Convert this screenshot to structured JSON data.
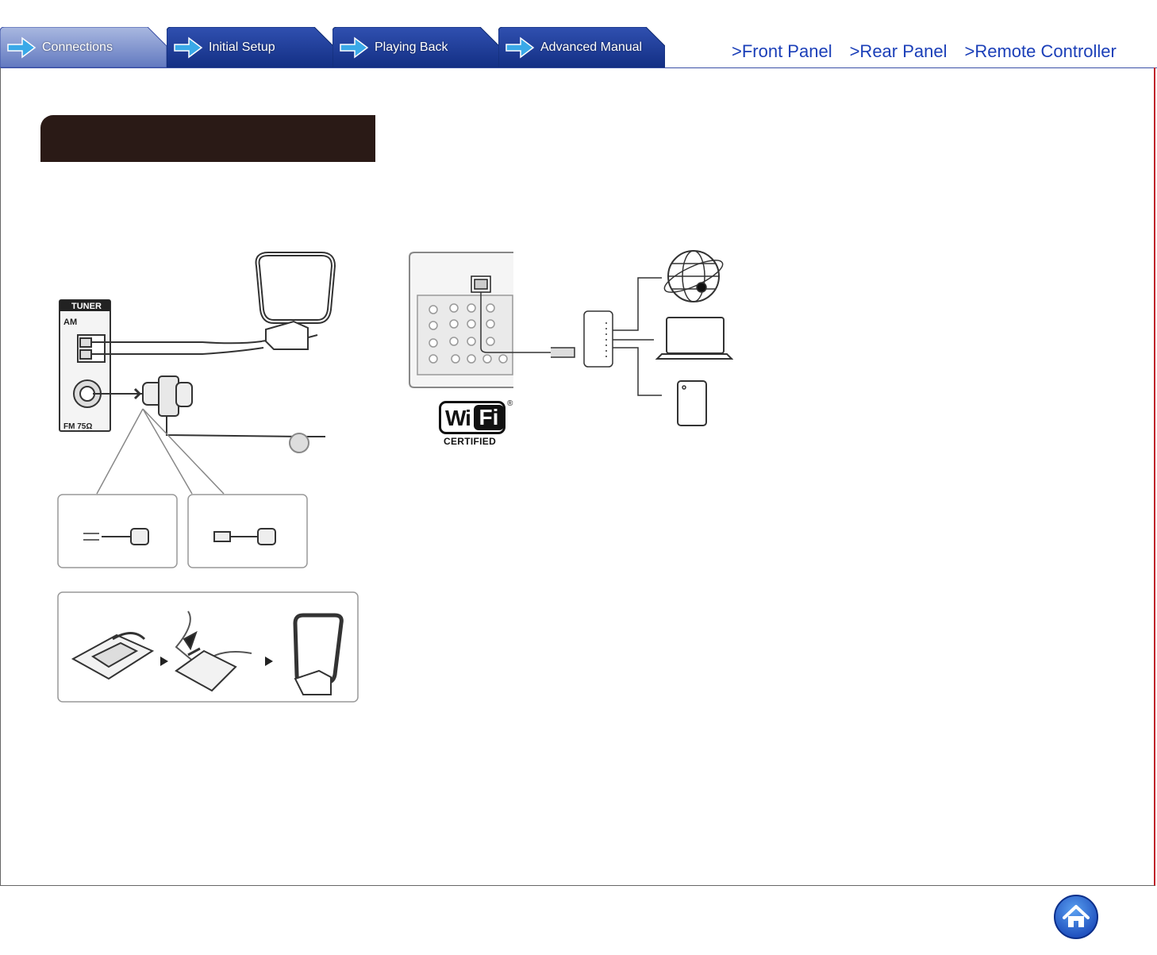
{
  "tabs": [
    {
      "label": "Connections",
      "active": true
    },
    {
      "label": "Initial Setup",
      "active": false
    },
    {
      "label": "Playing Back",
      "active": false
    },
    {
      "label": "Advanced Manual",
      "active": false
    }
  ],
  "links": {
    "front_panel": ">Front Panel",
    "rear_panel": ">Rear Panel",
    "remote_controller": ">Remote Controller"
  },
  "section": {
    "title": ""
  },
  "tuner_panel": {
    "heading": "TUNER",
    "am_label": "AM",
    "fm_label": "FM 75Ω"
  },
  "wifi_logo": {
    "wi": "Wi",
    "fi": "Fi",
    "reg": "®",
    "certified": "CERTIFIED"
  },
  "colors": {
    "tab_active": "#6f86c8",
    "tab_inactive": "#1a3b95",
    "link": "#1b3fb8",
    "section_bar": "#2a1a16",
    "frame_right": "#c0222a"
  },
  "icons": {
    "home": "home-icon",
    "tab_arrow": "arrow-right-icon"
  }
}
